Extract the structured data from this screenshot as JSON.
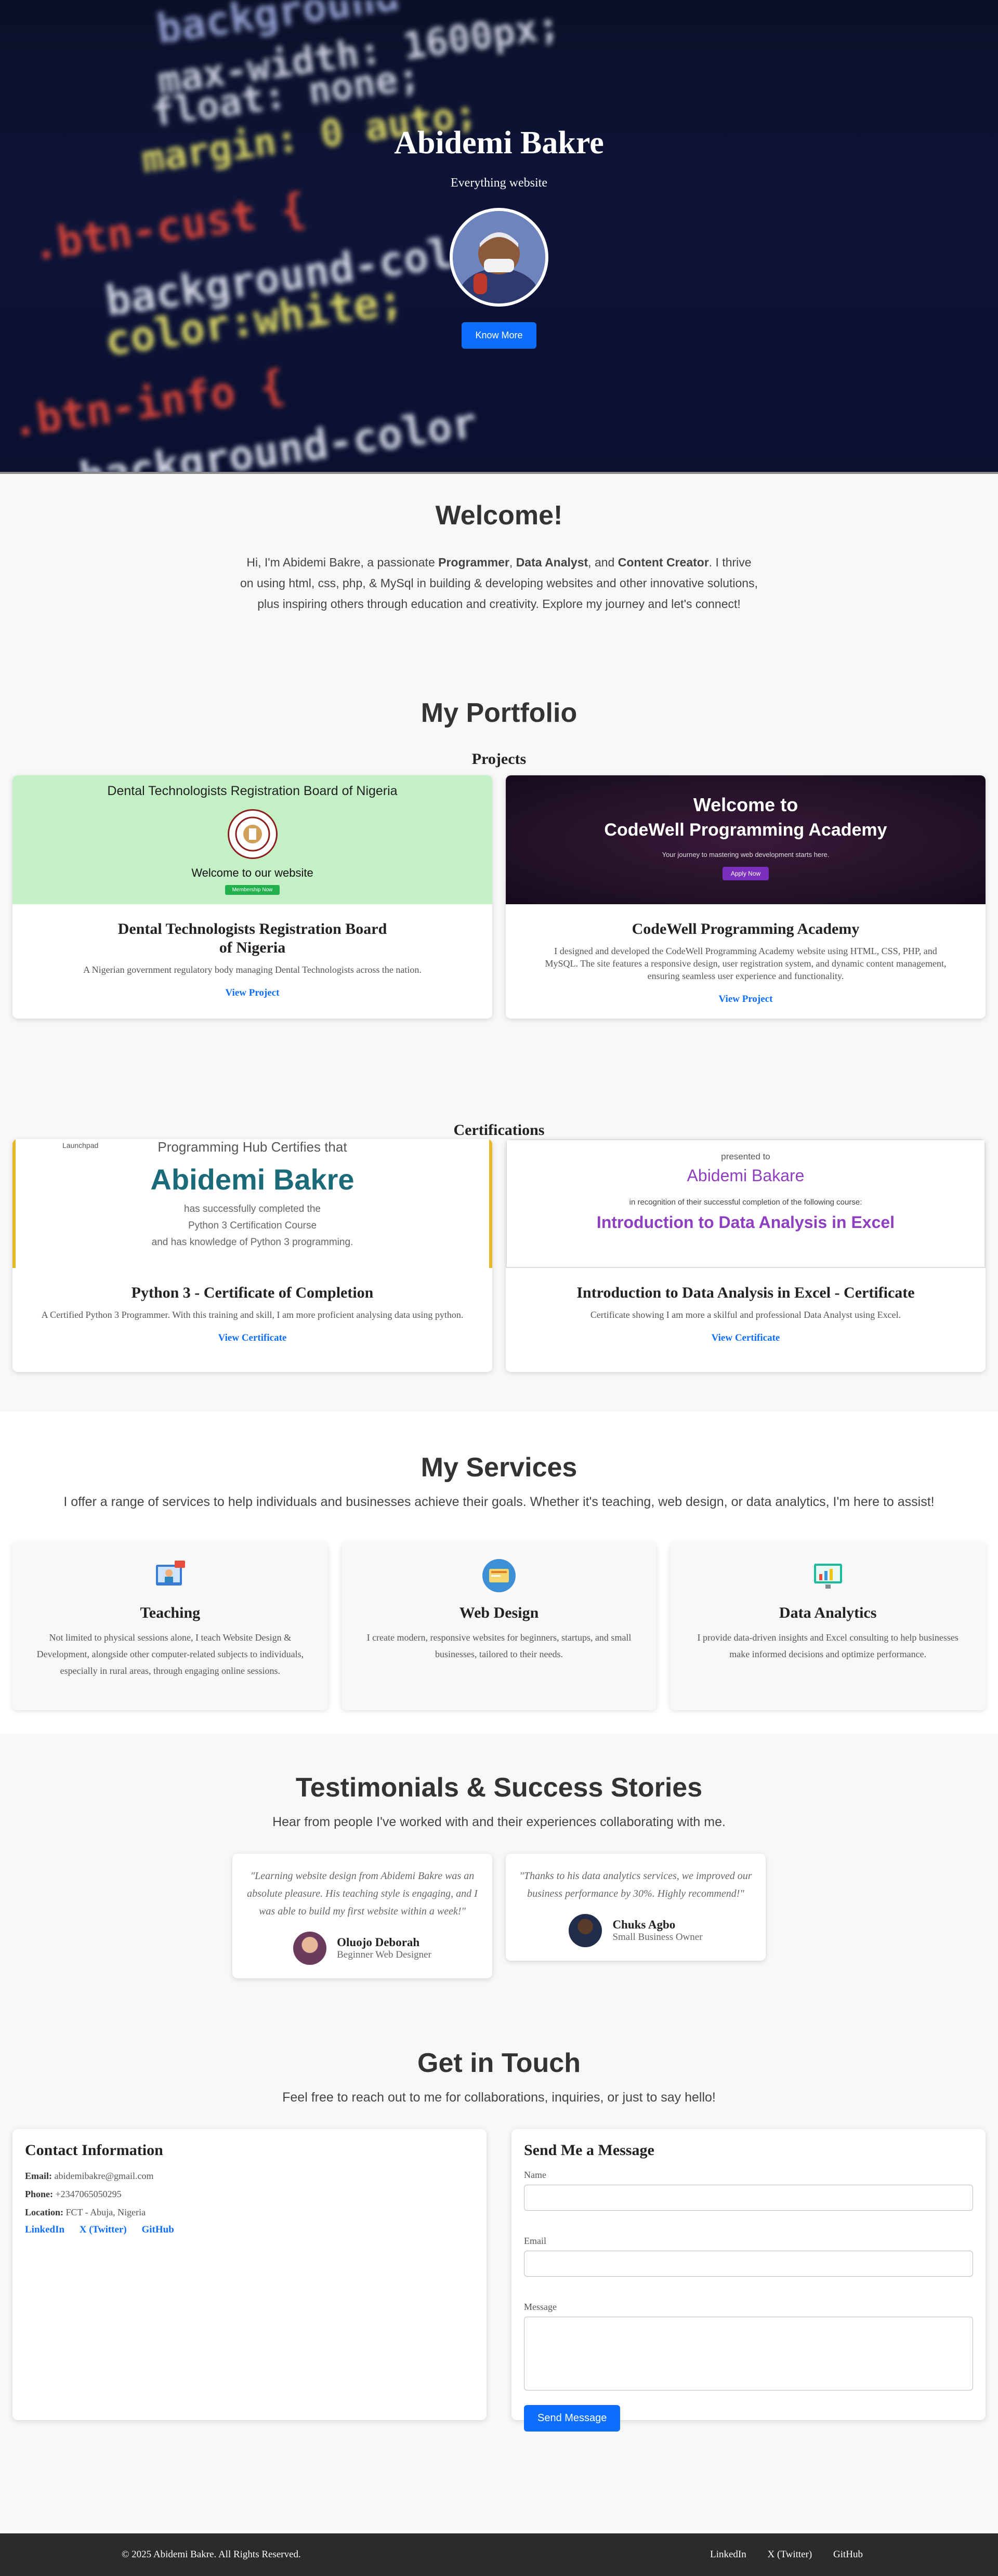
{
  "hero": {
    "title": "Abidemi Bakre",
    "tagline": "Everything website",
    "button": "Know More",
    "code_lines": [
      "background",
      "max-width: 1600px;",
      "float: none;",
      "margin: 0 auto;",
      ".btn-cust {",
      "background-color",
      "color:white;",
      "}",
      ".btn-info {",
      "background-color"
    ]
  },
  "welcome": {
    "heading": "Welcome!",
    "p1": "Hi, I'm Abidemi Bakre, a passionate ",
    "b1": "Programmer",
    "p2": ", ",
    "b2": "Data Analyst",
    "p3": ", and ",
    "b3": "Content Creator",
    "p4": ". I thrive on using html, css, php, & MySql in building & developing websites and other innovative solutions, plus inspiring others through education and creativity. Explore my journey and let's connect!"
  },
  "portfolio": {
    "heading": "My Portfolio",
    "projects_heading": "Projects",
    "projects": [
      {
        "thumb_title": "Dental Technologists Registration Board of Nigeria",
        "thumb_sub": "Welcome to our website",
        "thumb_btn": "Membership Now",
        "title": "Dental Technologists Registration Board of Nigeria",
        "desc": "A Nigerian government regulatory body managing Dental Technologists across the nation.",
        "link": "View Project"
      },
      {
        "thumb_title": "Welcome to",
        "thumb_sub": "CodeWell Programming Academy",
        "thumb_small": "Your journey to mastering web development starts here.",
        "thumb_btn": "Apply Now",
        "title": "CodeWell Programming Academy",
        "desc": "I designed and developed the CodeWell Programming Academy website using HTML, CSS, PHP, and MySQL. The site features a responsive design, user registration system, and dynamic content management, ensuring seamless user experience and functionality.",
        "link": "View Project"
      }
    ],
    "certs_heading": "Certifications",
    "certs": [
      {
        "t1": "Programming Hub Certifies that",
        "t2": "Abidemi Bakre",
        "t3": "has successfully completed the",
        "t4": "Python 3 Certification Course",
        "t5": "and has knowledge of Python 3 programming.",
        "logo": "Launchpad",
        "title": "Python 3 - Certificate of Completion",
        "desc": "A Certified Python 3 Programmer. With this training and skill, I am more proficient analysing data using python.",
        "link": "View Certificate"
      },
      {
        "t1": "presented to",
        "t2": "Abidemi Bakare",
        "t3": "in recognition of their successful completion of the following course:",
        "t4": "Introduction to Data Analysis in Excel",
        "title": "Introduction to Data Analysis in Excel - Certificate",
        "desc": "Certificate showing I am more a skilful and professional Data Analyst using Excel.",
        "link": "View Certificate"
      }
    ]
  },
  "services": {
    "heading": "My Services",
    "lead": "I offer a range of services to help individuals and businesses achieve their goals. Whether it's teaching, web design, or data analytics, I'm here to assist!",
    "items": [
      {
        "title": "Teaching",
        "desc": "Not limited to physical sessions alone, I teach Website Design & Development, alongside other computer-related subjects to individuals, especially in rural areas, through engaging online sessions."
      },
      {
        "title": "Web Design",
        "desc": "I create modern, responsive websites for beginners, startups, and small businesses, tailored to their needs."
      },
      {
        "title": "Data Analytics",
        "desc": "I provide data-driven insights and Excel consulting to help businesses make informed decisions and optimize performance."
      }
    ]
  },
  "testimonials": {
    "heading": "Testimonials & Success Stories",
    "lead": "Hear from people I've worked with and their experiences collaborating with me.",
    "items": [
      {
        "quote": "\"Learning website design from Abidemi Bakre was an absolute pleasure. His teaching style is engaging, and I was able to build my first website within a week!\"",
        "name": "Oluojo Deborah",
        "role": "Beginner Web Designer"
      },
      {
        "quote": "\"Thanks to his data analytics services, we improved our business performance by 30%. Highly recommend!\"",
        "name": "Chuks Agbo",
        "role": "Small Business Owner"
      }
    ]
  },
  "contact": {
    "heading": "Get in Touch",
    "lead": "Feel free to reach out to me for collaborations, inquiries, or just to say hello!",
    "info_heading": "Contact Information",
    "email_label": "Email:",
    "email": "abidemibakre@gmail.com",
    "phone_label": "Phone:",
    "phone": "+2347065050295",
    "location_label": "Location:",
    "location": "FCT - Abuja, Nigeria",
    "links": [
      "LinkedIn",
      "X (Twitter)",
      "GitHub"
    ],
    "form_heading": "Send Me a Message",
    "name_label": "Name",
    "email_field_label": "Email",
    "message_label": "Message",
    "send": "Send Message"
  },
  "footer": {
    "copyright": "© 2025 Abidemi Bakre. All Rights Reserved.",
    "links": [
      "LinkedIn",
      "X (Twitter)",
      "GitHub"
    ]
  },
  "colors": {
    "accent": "#0d6efd",
    "hero_bg": "#0d1438",
    "footer_bg": "#2b2b2b"
  }
}
